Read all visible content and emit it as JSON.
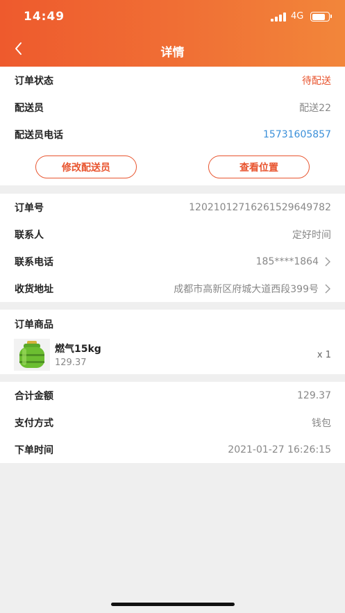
{
  "status_bar": {
    "time": "14:49",
    "network": "4G",
    "battery_level": 0.85
  },
  "nav": {
    "title": "详情",
    "back_icon": "chevron-left-icon"
  },
  "delivery": {
    "order_status_label": "订单状态",
    "order_status_value": "待配送",
    "courier_label": "配送员",
    "courier_value": "配送22",
    "courier_phone_label": "配送员电话",
    "courier_phone_value": "15731605857",
    "modify_courier_label": "修改配送员",
    "view_location_label": "查看位置"
  },
  "order_info": {
    "order_no_label": "订单号",
    "order_no_value": "120210127162615296497​82",
    "contact_label": "联系人",
    "contact_value": "定好时间",
    "contact_phone_label": "联系电话",
    "contact_phone_value": "185****1864",
    "address_label": "收货地址",
    "address_value": "成都市高新区府城大道西段399号"
  },
  "products": {
    "section_title": "订单商品",
    "items": [
      {
        "name": "燃气15kg",
        "price": "129.37",
        "quantity": "x 1",
        "icon": "gas-cylinder-icon"
      }
    ]
  },
  "payment": {
    "total_label": "合计金额",
    "total_value": "129.37",
    "method_label": "支付方式",
    "method_value": "钱包",
    "time_label": "下单时间",
    "time_value": "2021-01-27 16:26:15"
  },
  "colors": {
    "accent": "#e8542e",
    "phone": "#3a8fd9",
    "header_start": "#ee5a2d",
    "header_end": "#f2863a"
  }
}
